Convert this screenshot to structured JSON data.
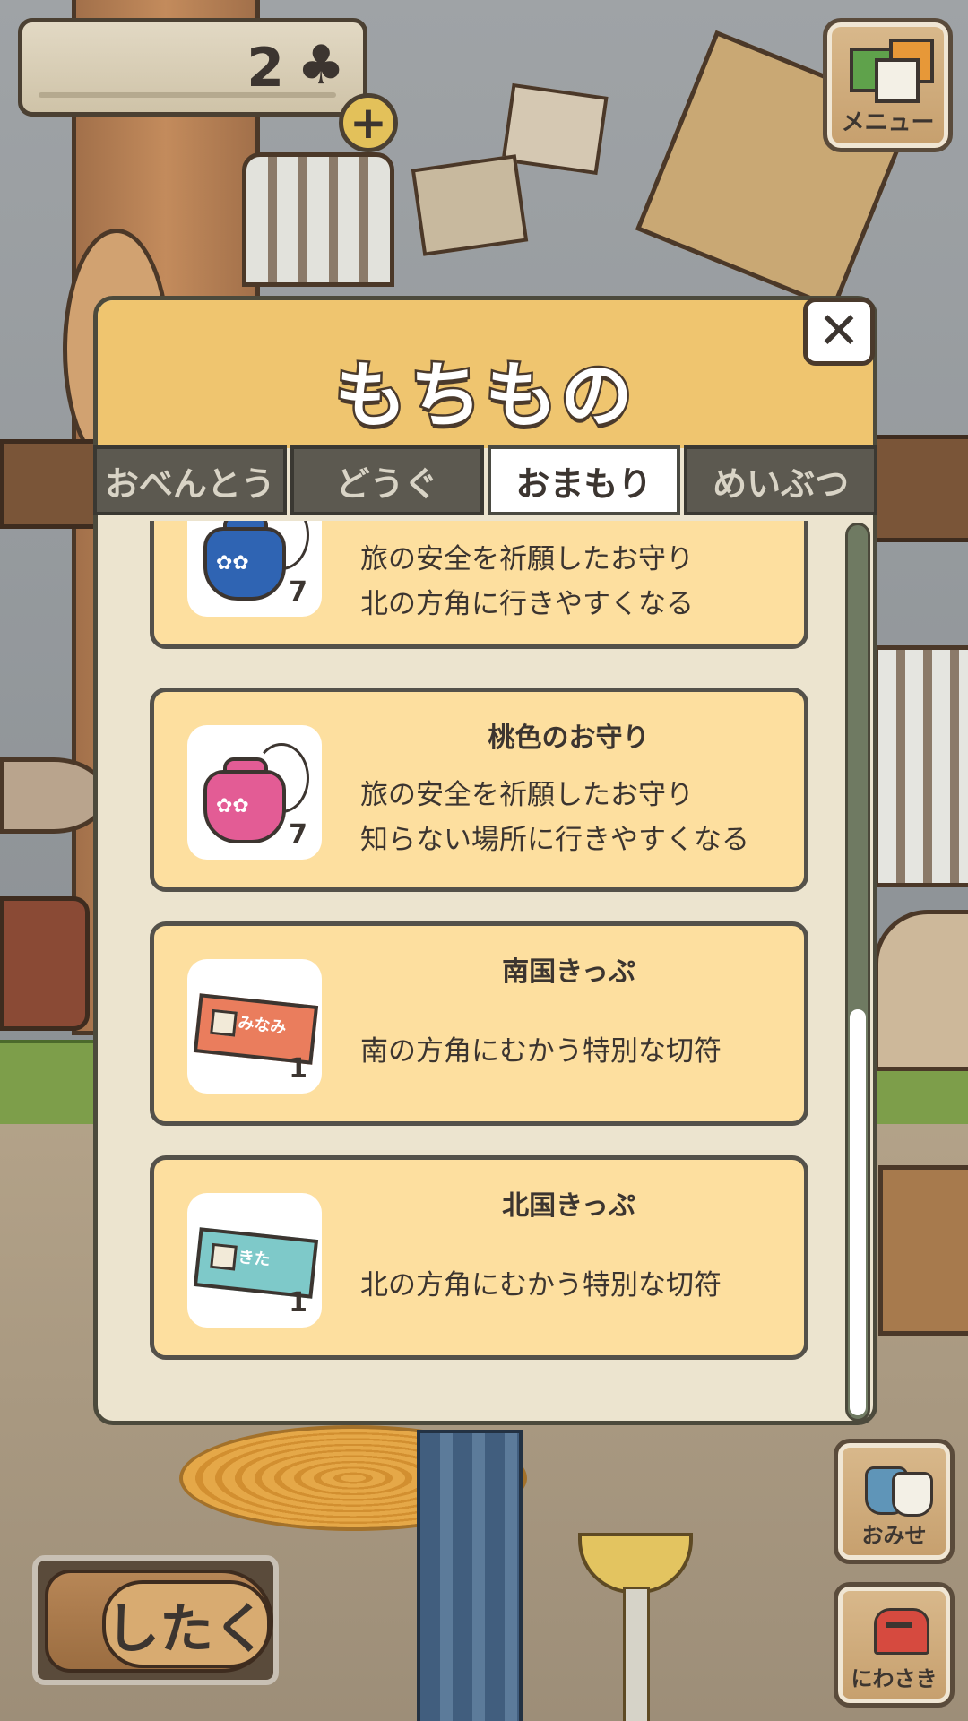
{
  "hud": {
    "clover_count": "2",
    "clover_symbol": "♣",
    "plus_symbol": "+",
    "menu_label": "メニュー",
    "shitaku_label": "したく",
    "shop_label": "おみせ",
    "yard_label": "にわさき"
  },
  "dialog": {
    "title": "もちもの",
    "close_symbol": "✕",
    "tabs": [
      "おべんとう",
      "どうぐ",
      "おまもり",
      "めいぶつ"
    ],
    "active_tab": "おまもり"
  },
  "items": [
    {
      "name": "",
      "qty": "7",
      "desc1": "旅の安全を祈願したお守り",
      "desc2": "北の方角に行きやすくなる",
      "color": "#2f64b3",
      "icon": "blue-charm-icon"
    },
    {
      "name": "桃色のお守り",
      "qty": "7",
      "desc1": "旅の安全を祈願したお守り",
      "desc2": "知らない場所に行きやすくなる",
      "color": "#e35c95",
      "icon": "pink-charm-icon"
    },
    {
      "name": "南国きっぷ",
      "qty": "1",
      "desc1": "南の方角にむかう特別な切符",
      "ticket_text": "みなみ",
      "color": "#ea7d5d",
      "icon": "south-ticket-icon"
    },
    {
      "name": "北国きっぷ",
      "qty": "1",
      "desc1": "北の方角にむかう特別な切符",
      "ticket_text": "きた",
      "color": "#7ec9c9",
      "icon": "north-ticket-icon"
    }
  ]
}
